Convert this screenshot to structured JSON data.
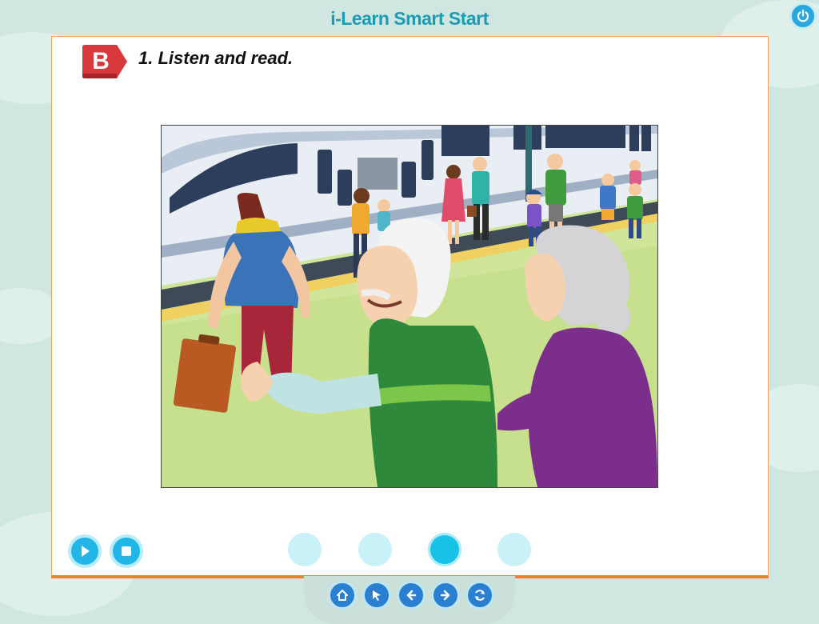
{
  "app": {
    "title": "i-Learn Smart Start"
  },
  "section": {
    "badge_letter": "B",
    "instruction": "1. Listen and read."
  },
  "scene": {
    "image_description_icon": "train-station-illustration"
  },
  "controls": {
    "play_icon": "play-icon",
    "stop_icon": "stop-icon"
  },
  "pagination": {
    "pages": 4,
    "active_page": 3
  },
  "navigation": {
    "buttons": [
      "home-icon",
      "cursor-icon",
      "back-icon",
      "forward-icon",
      "refresh-icon"
    ]
  },
  "colors": {
    "title": "#1c9bb5",
    "badge": "#d8393c",
    "panel_border": "#ee7f3a",
    "button": "#22b6e8",
    "nav_button": "#2b7fd1"
  }
}
